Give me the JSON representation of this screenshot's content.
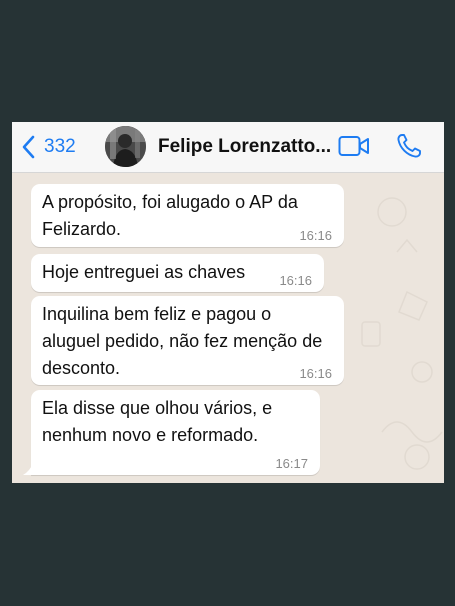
{
  "header": {
    "back_count": "332",
    "contact_name": "Felipe Lorenzatto..."
  },
  "icons": {
    "back": "chevron-left-icon",
    "video": "video-camera-icon",
    "call": "phone-icon"
  },
  "colors": {
    "accent": "#1E7CF2",
    "chat_background": "#ECE5DD",
    "bubble": "#FFFFFF",
    "outer_background": "#263335"
  },
  "messages": [
    {
      "text": "A propósito, foi alugado o AP da Felizardo.",
      "time": "16:16"
    },
    {
      "text": "Hoje entreguei as chaves",
      "time": "16:16"
    },
    {
      "text": "Inquilina bem feliz e pagou o aluguel pedido, não fez menção de desconto.",
      "time": "16:16"
    },
    {
      "text": "Ela disse que olhou vários, e nenhum novo e reformado.",
      "time": "16:17"
    }
  ]
}
